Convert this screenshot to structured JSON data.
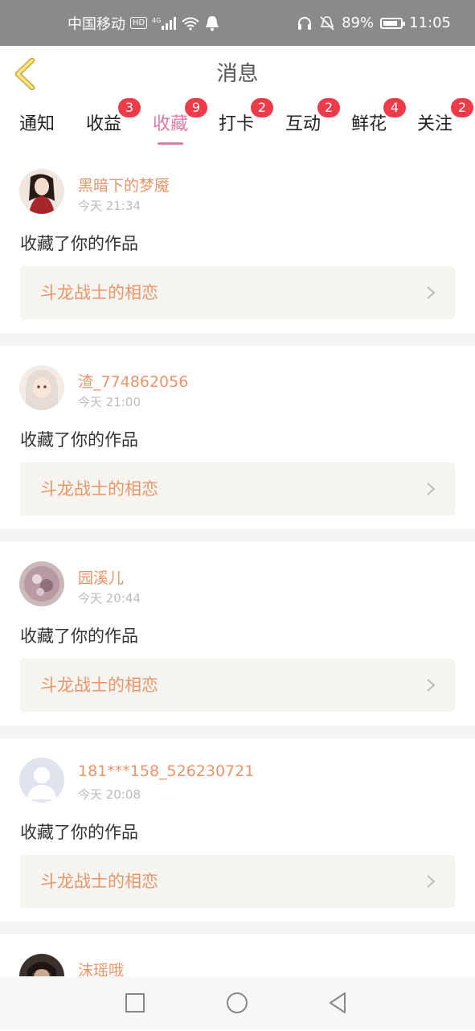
{
  "status_bar": {
    "carrier": "中国移动",
    "hd": "HD",
    "network": "4G",
    "battery": "89%",
    "time": "11:05",
    "icons": [
      "signal-icon",
      "wifi-icon",
      "notification-bell-icon",
      "headphone-icon",
      "mute-icon",
      "battery-icon"
    ]
  },
  "header": {
    "title": "消息",
    "back_icon": "chevron-left-icon"
  },
  "tabs": [
    {
      "label": "通知",
      "badge": ""
    },
    {
      "label": "收益",
      "badge": "3"
    },
    {
      "label": "收藏",
      "badge": "9",
      "active": true
    },
    {
      "label": "打卡",
      "badge": "2"
    },
    {
      "label": "互动",
      "badge": "2"
    },
    {
      "label": "鲜花",
      "badge": "4"
    },
    {
      "label": "关注",
      "badge": "2"
    }
  ],
  "messages": [
    {
      "username": "黑暗下的梦魇",
      "time": "今天 21:34",
      "action": "收藏了你的作品",
      "work": "斗龙战士的相恋"
    },
    {
      "username": "渣_774862056",
      "time": "今天 21:00",
      "action": "收藏了你的作品",
      "work": "斗龙战士的相恋"
    },
    {
      "username": "园溪儿",
      "time": "今天 20:44",
      "action": "收藏了你的作品",
      "work": "斗龙战士的相恋"
    },
    {
      "username": "181***158_526230721",
      "time": "今天 20:08",
      "action": "收藏了你的作品",
      "work": "斗龙战士的相恋"
    },
    {
      "username": "沫瑶哦"
    }
  ],
  "colors": {
    "accent": "#e07aa6",
    "username": "#e8956a",
    "badge": "#ee3b4a",
    "card_bg": "#f5f4ee"
  },
  "nav_icons": [
    "recent-apps-icon",
    "home-icon",
    "back-icon"
  ]
}
